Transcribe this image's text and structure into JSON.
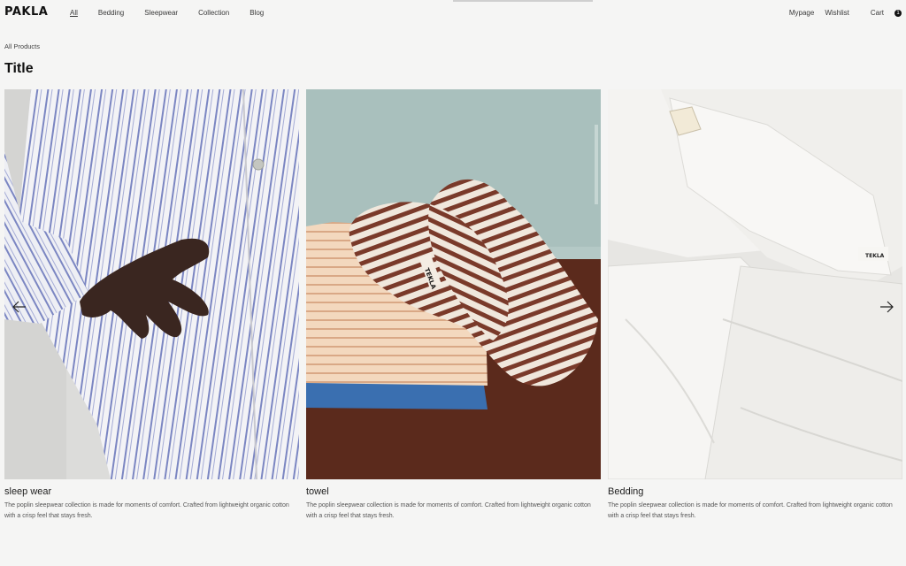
{
  "header": {
    "logo": "PAKLA",
    "nav": [
      "All",
      "Bedding",
      "Sleepwear",
      "Collection",
      "Blog"
    ],
    "utilities": {
      "mypage": "Mypage",
      "wishlist": "Wishlist",
      "cart": "Cart",
      "cart_count": "1"
    }
  },
  "breadcrumb": "All Products",
  "page_title": "Title",
  "carousel": {
    "prev_icon": "arrow-left-icon",
    "next_icon": "arrow-right-icon",
    "products": [
      {
        "name": "sleep wear",
        "description": "The poplin sleepwear collection is made for moments of comfort. Crafted from lightweight organic cotton with a crisp feel that stays fresh."
      },
      {
        "name": "towel",
        "description": "The poplin sleepwear collection is made for moments of comfort. Crafted from lightweight organic cotton with a crisp feel that stays fresh.",
        "label": "TEKLA"
      },
      {
        "name": "Bedding",
        "description": "The poplin sleepwear collection is made for moments of comfort. Crafted from lightweight organic cotton with a crisp feel that stays fresh.",
        "label": "TEKLA"
      }
    ]
  },
  "colors": {
    "background": "#f5f5f4",
    "text": "#1a1a1a",
    "stripe_blue": "#7b86c2",
    "stripe_brown": "#7a3a2a"
  }
}
